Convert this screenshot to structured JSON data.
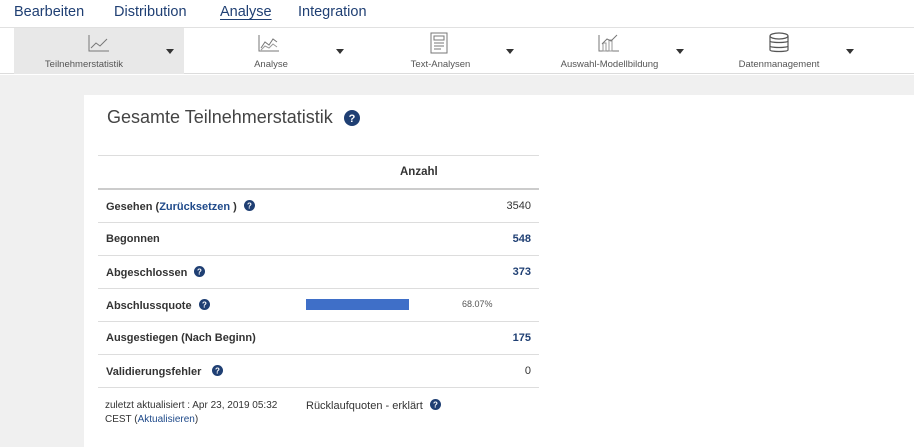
{
  "topnav": {
    "items": [
      "Bearbeiten",
      "Distribution",
      "Analyse",
      "Integration"
    ],
    "active": "Analyse"
  },
  "toolbar": {
    "items": [
      {
        "label": "Teilnehmerstatistik",
        "icon": "line-chart-icon",
        "active": true
      },
      {
        "label": "Analyse",
        "icon": "area-chart-icon",
        "active": false
      },
      {
        "label": "Text-Analysen",
        "icon": "text-document-icon",
        "active": false
      },
      {
        "label": "Auswahl-Modellbildung",
        "icon": "bar-line-chart-icon",
        "active": false
      },
      {
        "label": "Datenmanagement",
        "icon": "database-icon",
        "active": false
      }
    ]
  },
  "panel": {
    "title": "Gesamte Teilnehmerstatistik",
    "column_header": "Anzahl"
  },
  "rows": {
    "seen": {
      "label_prefix": "Gesehen (",
      "link": "Zurücksetzen",
      "label_suffix": ")",
      "value": "3540"
    },
    "started": {
      "label": "Begonnen",
      "value": "548"
    },
    "completed": {
      "label": "Abgeschlossen",
      "value": "373"
    },
    "completion_rate": {
      "label": "Abschlussquote",
      "value_text": "68.07%",
      "fraction": 0.6807
    },
    "dropped": {
      "label": "Ausgestiegen (Nach Beginn)",
      "value": "175"
    },
    "validation": {
      "label": "Validierungsfehler",
      "value": "0"
    }
  },
  "footer": {
    "updated_prefix": "zuletzt aktualisiert : Apr 23, 2019 05:32 CEST (",
    "refresh_link": "Aktualisieren",
    "updated_suffix": ")",
    "explained": "Rücklaufquoten - erklärt"
  },
  "colors": {
    "link": "#1f3f73",
    "bar": "#3f6fc8",
    "background": "#f0f0f0"
  }
}
